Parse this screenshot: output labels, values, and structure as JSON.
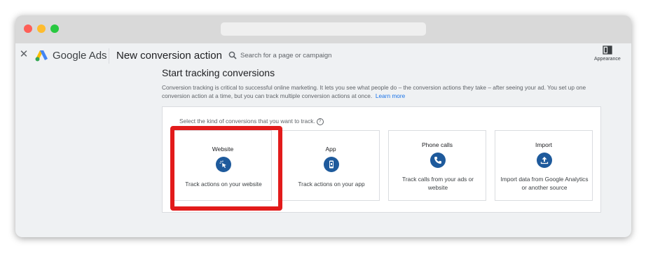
{
  "browser": {
    "url": ""
  },
  "appbar": {
    "brand": "Google Ads",
    "page_title": "New conversion action",
    "search_placeholder": "Search for a page or campaign",
    "appearance_label": "Appearance"
  },
  "main": {
    "title": "Start tracking conversions",
    "description": "Conversion tracking is critical to successful online marketing. It lets you see what people do – the conversion actions they take – after seeing your ad. You set up one conversion action at a time, but you can track multiple conversion actions at once.",
    "learn_more": "Learn more",
    "prompt": "Select the kind of conversions that you want to track.",
    "cards": [
      {
        "title": "Website",
        "icon": "cursor-click-icon",
        "description": "Track actions on your website"
      },
      {
        "title": "App",
        "icon": "phone-app-icon",
        "description": "Track actions on your app"
      },
      {
        "title": "Phone calls",
        "icon": "phone-call-icon",
        "description": "Track calls from your ads or website"
      },
      {
        "title": "Import",
        "icon": "upload-icon",
        "description": "Import data from Google Analytics or another source"
      }
    ]
  },
  "colors": {
    "accent": "#1a73e8",
    "icon_bg": "#1e5a9c",
    "highlight": "#e21b1b"
  }
}
